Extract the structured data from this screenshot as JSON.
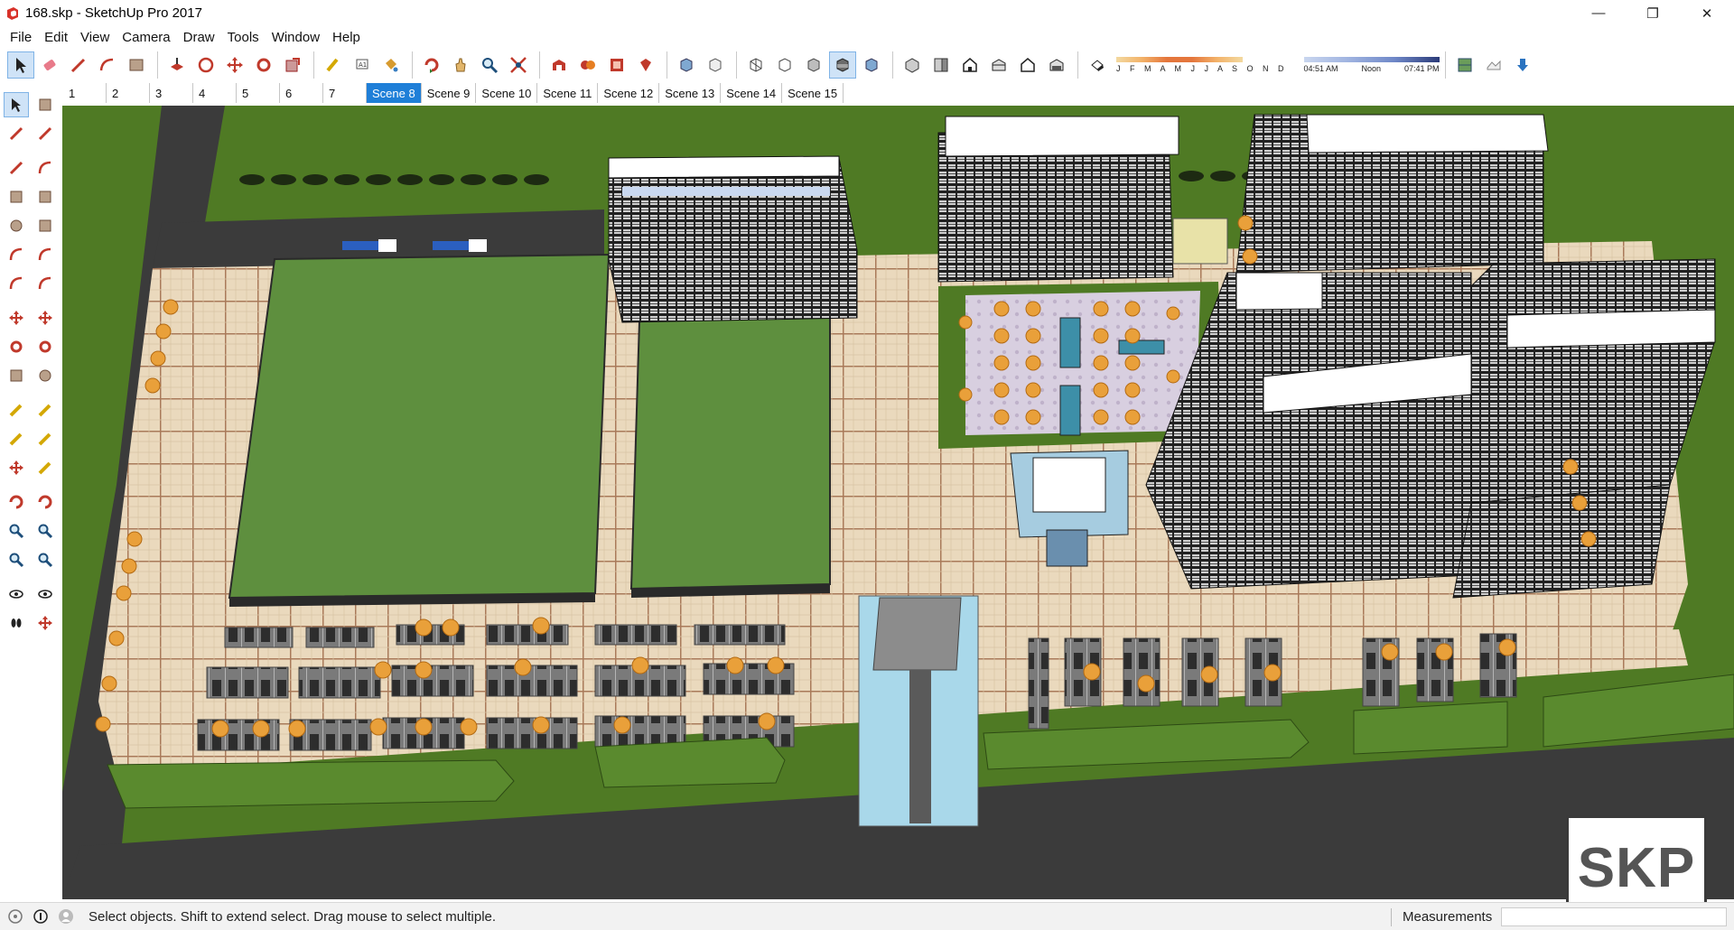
{
  "window": {
    "title": "168.skp - SketchUp Pro 2017",
    "minimize": "—",
    "restore": "❐",
    "close": "✕"
  },
  "menu": [
    "File",
    "Edit",
    "View",
    "Camera",
    "Draw",
    "Tools",
    "Window",
    "Help"
  ],
  "shadow": {
    "months": "J F M A M J J A S O N D",
    "time_start": "04:51 AM",
    "time_mid": "Noon",
    "time_end": "07:41 PM"
  },
  "scenes": {
    "numbered": [
      "1",
      "2",
      "3",
      "4",
      "5",
      "6",
      "7"
    ],
    "named": [
      "Scene 8",
      "Scene 9",
      "Scene 10",
      "Scene 11",
      "Scene 12",
      "Scene 13",
      "Scene 14",
      "Scene 15"
    ],
    "active": "Scene 8"
  },
  "toolbar_icons": [
    "select-icon",
    "eraser-icon",
    "line-icon",
    "arc-icon",
    "rectangle-icon",
    "push-pull-icon",
    "offset-icon",
    "move-icon",
    "rotate-icon",
    "scale-icon",
    "tape-measure-icon",
    "text-icon",
    "paint-bucket-icon",
    "orbit-icon",
    "pan-icon",
    "zoom-icon",
    "zoom-extents-icon",
    "warehouse-icon",
    "extension-warehouse-icon",
    "layout-icon",
    "ruby-icon",
    "xray-icon",
    "back-edges-icon",
    "wireframe-icon",
    "hidden-line-icon",
    "shaded-icon",
    "shaded-textures-icon",
    "monochrome-icon",
    "iso-view-icon",
    "top-view-icon",
    "front-view-icon",
    "right-view-icon",
    "back-view-icon",
    "left-view-icon",
    "shadows-toggle-icon",
    "add-location-icon",
    "toggle-terrain-icon",
    "photo-textures-icon"
  ],
  "left_tools": [
    [
      "select-icon",
      "component-icon"
    ],
    [
      "paint-bucket-icon",
      "eraser-icon"
    ],
    [
      "line-icon",
      "freehand-icon"
    ],
    [
      "rectangle-icon",
      "rotated-rectangle-icon"
    ],
    [
      "circle-icon",
      "polygon-icon"
    ],
    [
      "arc-icon",
      "two-point-arc-icon"
    ],
    [
      "three-point-arc-icon",
      "pie-icon"
    ],
    [
      "move-icon",
      "push-pull-icon"
    ],
    [
      "rotate-icon",
      "follow-me-icon"
    ],
    [
      "scale-icon",
      "offset-icon"
    ],
    [
      "tape-measure-icon",
      "dimension-icon"
    ],
    [
      "protractor-icon",
      "text-icon"
    ],
    [
      "axes-icon",
      "3d-text-icon"
    ],
    [
      "orbit-icon",
      "pan-icon"
    ],
    [
      "zoom-icon",
      "zoom-window-icon"
    ],
    [
      "zoom-extents-icon",
      "previous-view-icon"
    ],
    [
      "position-camera-icon",
      "look-around-icon"
    ],
    [
      "walk-icon",
      "section-plane-icon"
    ]
  ],
  "badge": {
    "text": "SKP"
  },
  "status": {
    "message": "Select objects. Shift to extend select. Drag mouse to select multiple.",
    "measurements_label": "Measurements",
    "measurements_value": ""
  },
  "colors": {
    "active_tab": "#1f7fd8",
    "grass": "#4f7a24",
    "lawn": "#5e8f3e",
    "pavement": "#e8d9c0",
    "road": "#3a3a3a",
    "water": "#a9d8ea"
  }
}
